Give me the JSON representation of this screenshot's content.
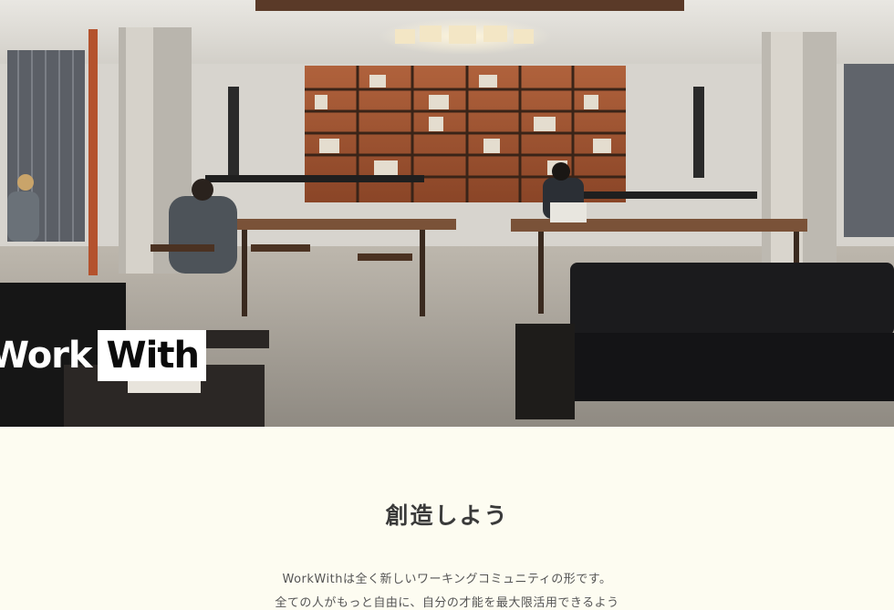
{
  "hero": {
    "photo_subject": "coworking lounge",
    "logo": {
      "part1": "Work",
      "part2": "With"
    }
  },
  "intro": {
    "title": "創造しよう",
    "lines": [
      "WorkWithは全く新しいワーキングコミュニティの形です。",
      "全ての人がもっと自由に、自分の才能を最大限活用できるよう"
    ]
  },
  "colors": {
    "page_bg": "#fdfcf1",
    "title_text": "#3a3a3a",
    "logo_box": "#ffffff"
  }
}
